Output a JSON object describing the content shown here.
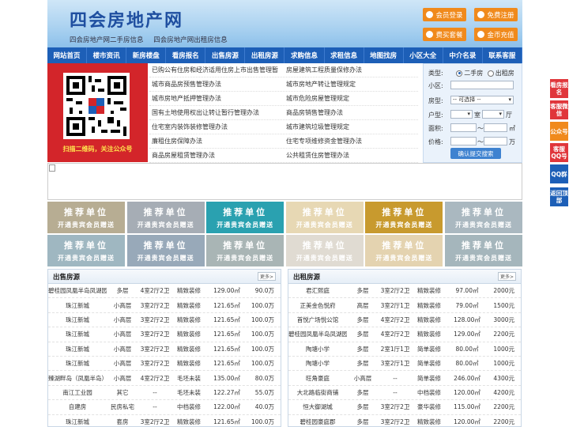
{
  "header": {
    "site_title": "四会房地产网",
    "sub_links": [
      "四会房地产网二手房信息",
      "四会房地产网出租房信息"
    ],
    "buttons": [
      "会员登录",
      "免费注册",
      "费买套餐",
      "金币充值"
    ]
  },
  "nav": [
    "网站首页",
    "楼市资讯",
    "新房楼盘",
    "看房报名",
    "出售房源",
    "出租房源",
    "求购信息",
    "求租信息",
    "地图找房",
    "小区大全",
    "中介名录",
    "联系客服"
  ],
  "qr": {
    "caption": "扫描二维码，关注公众号"
  },
  "links": [
    [
      "已购公有住房和经济适用住房上市出售管理暂",
      "房屋建筑工程质量保修办法"
    ],
    [
      "城市商品房预售管理办法",
      "城市房地产转让管理规定"
    ],
    [
      "城市房地产抵押管理办法",
      "城市危险房屋管理规定"
    ],
    [
      "国有土地使用权出让转让暂行管理办法",
      "商品房销售管理办法"
    ],
    [
      "住宅室内装饰装修管理办法",
      "城市建筑垃圾管理规定"
    ],
    [
      "廉租住房保障办法",
      "住宅专项维修资金管理办法"
    ],
    [
      "商品房屋租赁管理办法",
      "公共租赁住房管理办法"
    ]
  ],
  "search": {
    "type_label": "类型:",
    "opt_sale": "二手房",
    "opt_rent": "出租房",
    "area_label": "小区:",
    "kind_label": "房型:",
    "kind_value": "-- 可选择 --",
    "layout_label": "户型:",
    "room_unit": "室",
    "hall_unit": "厅",
    "size_label": "面积:",
    "size_unit": "㎡",
    "price_label": "价格:",
    "price_unit": "万",
    "tilde": "～",
    "submit": "确认提交搜索"
  },
  "tiles": {
    "line1": "推荐单位",
    "line2": "开通贵宾会员赠送",
    "colors": [
      "#b7ad93",
      "#a6adb5",
      "#2aa1b0",
      "#e7d8b4",
      "#c89a2e",
      "#aab8c0",
      "#9fb7c1",
      "#98a9b9",
      "#a9b5b5",
      "#e0dbd2",
      "#e4d3b0",
      "#a5b6bc"
    ]
  },
  "sale": {
    "title": "出售房源",
    "more": "更多>",
    "rows": [
      [
        "碧桂园凤凰半岛凤湖园",
        "多层",
        "4室2厅2卫",
        "精致装修",
        "129.00㎡",
        "90.0万"
      ],
      [
        "珠江新城",
        "小高层",
        "3室2厅2卫",
        "精致装修",
        "121.65㎡",
        "100.0万"
      ],
      [
        "珠江新城",
        "小高层",
        "3室2厅2卫",
        "精致装修",
        "121.65㎡",
        "100.0万"
      ],
      [
        "珠江新城",
        "小高层",
        "3室2厅2卫",
        "精致装修",
        "121.65㎡",
        "100.0万"
      ],
      [
        "珠江新城",
        "小高层",
        "3室2厅2卫",
        "精致装修",
        "121.65㎡",
        "100.0万"
      ],
      [
        "珠江新城",
        "小高层",
        "3室2厅2卫",
        "精致装修",
        "121.65㎡",
        "100.0万"
      ],
      [
        "臻湖畔岛（凤凰半岛）",
        "小高层",
        "4室2厅2卫",
        "毛坯未装",
        "135.00㎡",
        "80.0万"
      ],
      [
        "南江工业园",
        "其它",
        "--",
        "毛坯未装",
        "122.27㎡",
        "55.0万"
      ],
      [
        "自建房",
        "民房私宅",
        "--",
        "中档装修",
        "122.00㎡",
        "40.0万"
      ],
      [
        "珠江新城",
        "套房",
        "3室2厅2卫",
        "精致装修",
        "121.65㎡",
        "100.0万"
      ]
    ]
  },
  "rent": {
    "title": "出租房源",
    "more": "更多>",
    "rows": [
      [
        "君汇熙庭",
        "多层",
        "3室2厅2卫",
        "精致装修",
        "97.00㎡",
        "2000元"
      ],
      [
        "正美金色悦府",
        "高层",
        "3室2厅1卫",
        "精致装修",
        "79.00㎡",
        "1500元"
      ],
      [
        "首悦广场悦公馆",
        "多层",
        "4室2厅2卫",
        "精致装修",
        "128.00㎡",
        "3000元"
      ],
      [
        "碧桂园凤凰半岛凤湖园",
        "多层",
        "4室2厅2卫",
        "精致装修",
        "129.00㎡",
        "2200元"
      ],
      [
        "陶塘小学",
        "多层",
        "2室1厅1卫",
        "简单装修",
        "80.00㎡",
        "1000元"
      ],
      [
        "陶塘小学",
        "多层",
        "3室2厅1卫",
        "简单装修",
        "80.00㎡",
        "1000元"
      ],
      [
        "旺角豪庭",
        "小高层",
        "--",
        "简单装修",
        "246.00㎡",
        "4300元"
      ],
      [
        "大北路临街商铺",
        "多层",
        "--",
        "中档装修",
        "120.00㎡",
        "4200元"
      ],
      [
        "恒大御湖城",
        "多层",
        "3室2厅2卫",
        "豪华装修",
        "115.00㎡",
        "2200元"
      ],
      [
        "碧桂园豪庭郡",
        "多层",
        "3室2厅2卫",
        "精致装修",
        "120.00㎡",
        "2200元"
      ]
    ]
  },
  "side": [
    "看房报名",
    "客服微信",
    "公众号",
    "客服QQ号",
    "QQ群",
    "返回顶部"
  ],
  "side_colors": [
    "#e0363b",
    "#e0363b",
    "#f08a1c",
    "#e0363b",
    "#1d5fb7",
    "#1d5fb7"
  ],
  "accent": "#1d5fb7"
}
